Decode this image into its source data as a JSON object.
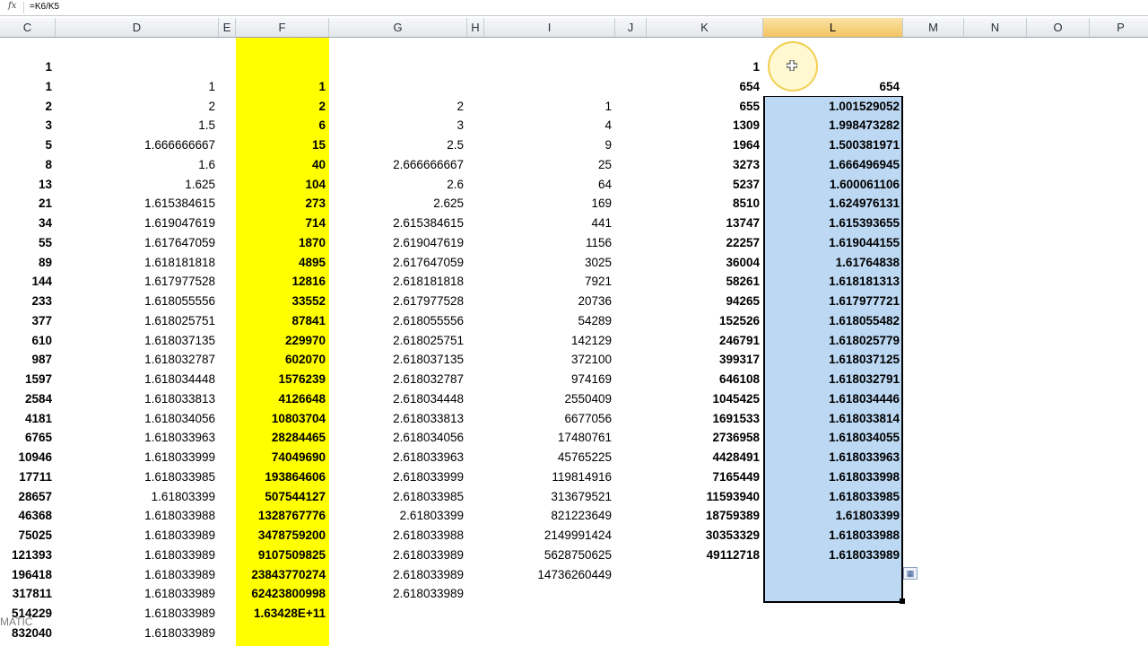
{
  "formula_bar": {
    "icon": "fx-icon",
    "formula": "=K6/K5"
  },
  "columns": [
    "C",
    "D",
    "E",
    "F",
    "G",
    "H",
    "I",
    "J",
    "K",
    "L",
    "M",
    "N",
    "O",
    "P"
  ],
  "selected_column": "L",
  "colors": {
    "highlight_column_F": "#ffff00",
    "selection": "#bcd8f3"
  },
  "sheet": {
    "C": [
      "1",
      "1",
      "2",
      "3",
      "5",
      "8",
      "13",
      "21",
      "34",
      "55",
      "89",
      "144",
      "233",
      "377",
      "610",
      "987",
      "1597",
      "2584",
      "4181",
      "6765",
      "10946",
      "17711",
      "28657",
      "46368",
      "75025",
      "121393",
      "196418",
      "317811",
      "514229",
      "832040"
    ],
    "D": [
      "",
      "1",
      "2",
      "1.5",
      "1.666666667",
      "1.6",
      "1.625",
      "1.615384615",
      "1.619047619",
      "1.617647059",
      "1.618181818",
      "1.617977528",
      "1.618055556",
      "1.618025751",
      "1.618037135",
      "1.618032787",
      "1.618034448",
      "1.618033813",
      "1.618034056",
      "1.618033963",
      "1.618033999",
      "1.618033985",
      "1.61803399",
      "1.618033988",
      "1.618033989",
      "1.618033989",
      "1.618033989",
      "1.618033989",
      "1.618033989",
      "1.618033989"
    ],
    "F": [
      "",
      "1",
      "2",
      "6",
      "15",
      "40",
      "104",
      "273",
      "714",
      "1870",
      "4895",
      "12816",
      "33552",
      "87841",
      "229970",
      "602070",
      "1576239",
      "4126648",
      "10803704",
      "28284465",
      "74049690",
      "193864606",
      "507544127",
      "1328767776",
      "3478759200",
      "9107509825",
      "23843770274",
      "62423800998",
      "1.63428E+11",
      ""
    ],
    "G": [
      "",
      "",
      "2",
      "3",
      "2.5",
      "2.666666667",
      "2.6",
      "2.625",
      "2.615384615",
      "2.619047619",
      "2.617647059",
      "2.618181818",
      "2.617977528",
      "2.618055556",
      "2.618025751",
      "2.618037135",
      "2.618032787",
      "2.618034448",
      "2.618033813",
      "2.618034056",
      "2.618033963",
      "2.618033999",
      "2.618033985",
      "2.61803399",
      "2.618033988",
      "2.618033989",
      "2.618033989",
      "2.618033989",
      "",
      ""
    ],
    "I": [
      "",
      "",
      "1",
      "4",
      "9",
      "25",
      "64",
      "169",
      "441",
      "1156",
      "3025",
      "7921",
      "20736",
      "54289",
      "142129",
      "372100",
      "974169",
      "2550409",
      "6677056",
      "17480761",
      "45765225",
      "119814916",
      "313679521",
      "821223649",
      "2149991424",
      "5628750625",
      "14736260449",
      "",
      "",
      ""
    ],
    "K": [
      "1",
      "654",
      "655",
      "1309",
      "1964",
      "3273",
      "5237",
      "8510",
      "13747",
      "22257",
      "36004",
      "58261",
      "94265",
      "152526",
      "246791",
      "399317",
      "646108",
      "1045425",
      "1691533",
      "2736958",
      "4428491",
      "7165449",
      "11593940",
      "18759389",
      "30353329",
      "49112718",
      "",
      "",
      "",
      ""
    ],
    "L": [
      "",
      "654",
      "1.001529052",
      "1.998473282",
      "1.500381971",
      "1.666496945",
      "1.600061106",
      "1.624976131",
      "1.615393655",
      "1.619044155",
      "1.61764838",
      "1.618181313",
      "1.617977721",
      "1.618055482",
      "1.618025779",
      "1.618037125",
      "1.618032791",
      "1.618034446",
      "1.618033814",
      "1.618034055",
      "1.618033963",
      "1.618033998",
      "1.618033985",
      "1.61803399",
      "1.618033988",
      "1.618033989",
      "",
      "",
      "",
      ""
    ]
  },
  "watermark": "MATIC"
}
